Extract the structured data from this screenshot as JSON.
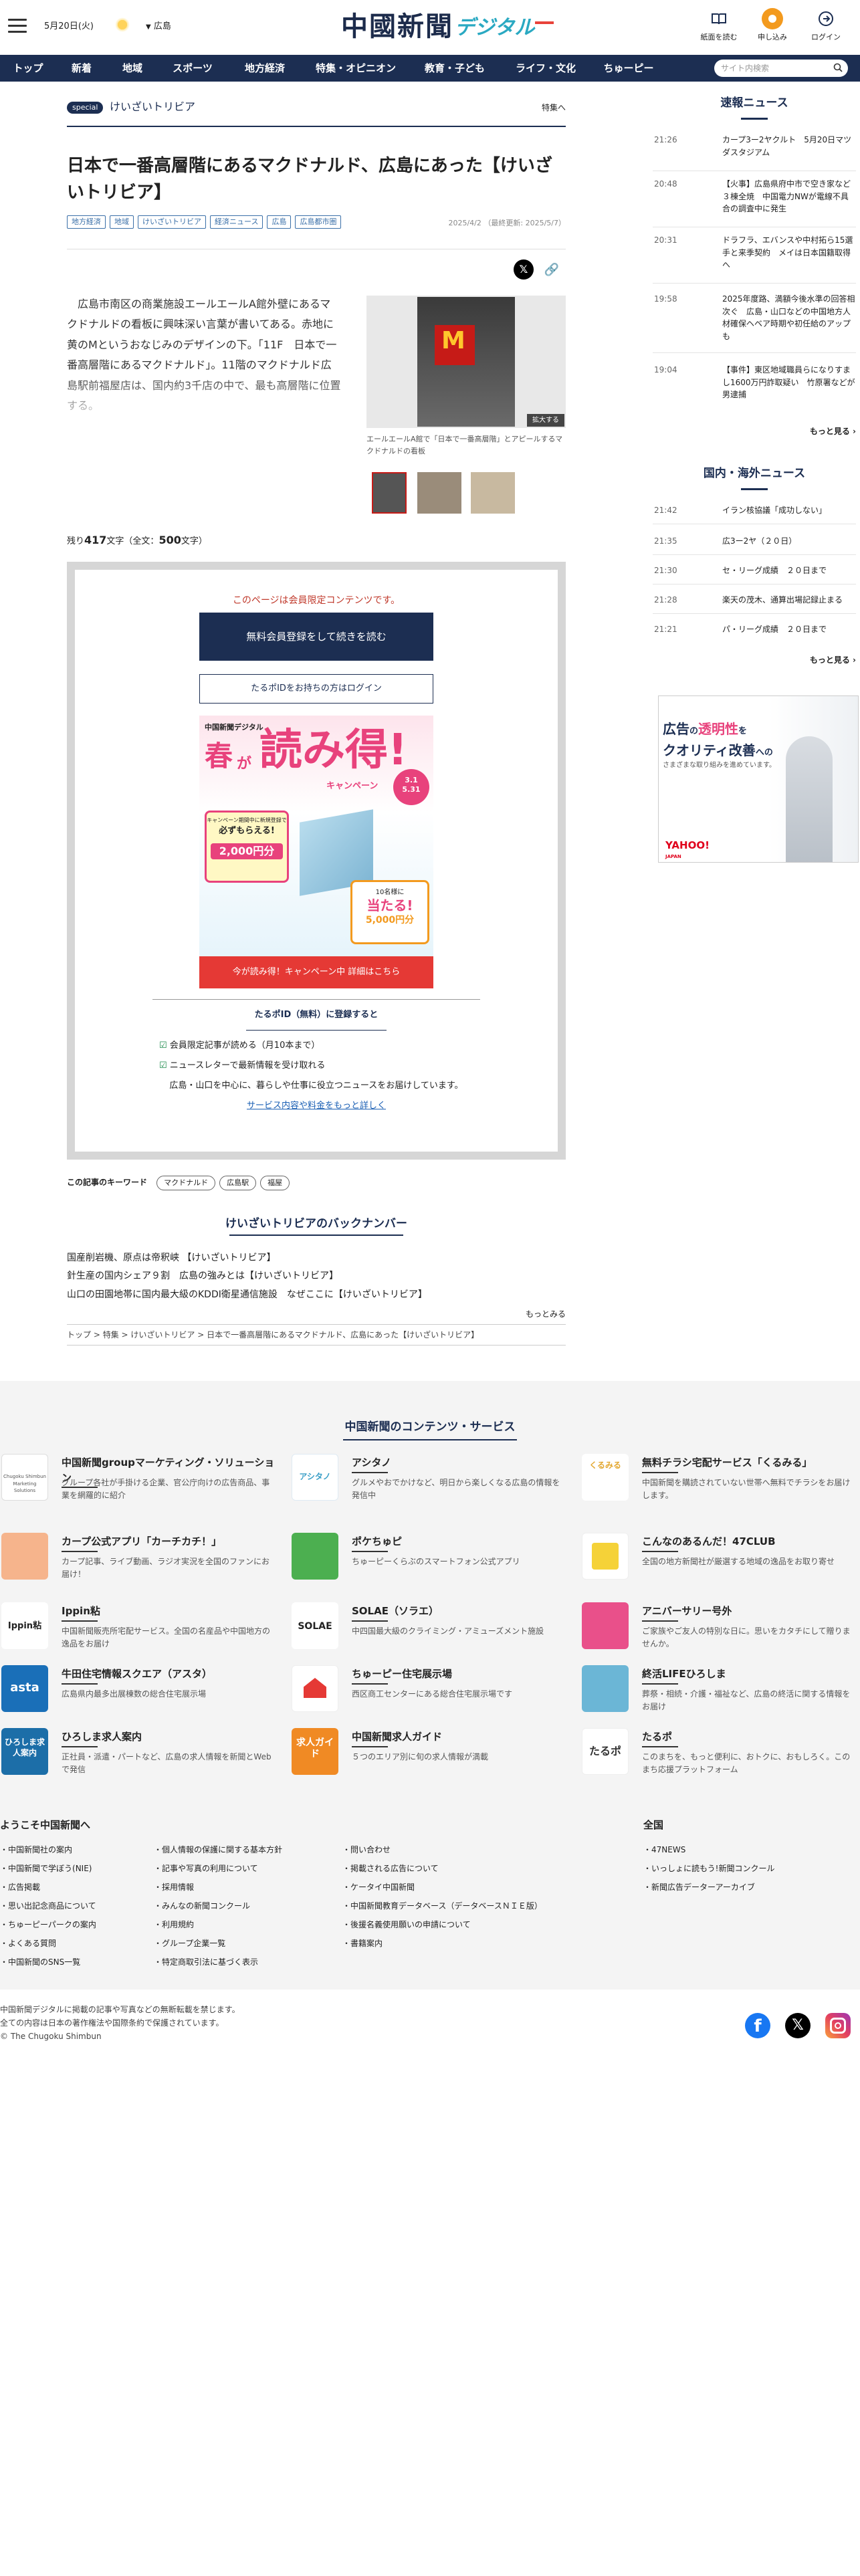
{
  "header": {
    "date": "5月20日(火)",
    "region": "広島",
    "logo_main": "中國新聞",
    "logo_sub": "デジタル",
    "buttons": [
      {
        "label": "紙面を読む"
      },
      {
        "label": "申し込み"
      },
      {
        "label": "ログイン"
      }
    ]
  },
  "nav": {
    "items": [
      "トップ",
      "新着",
      "地域",
      "スポーツ",
      "地方経済",
      "特集・オピニオン",
      "教育・子ども",
      "ライフ・文化",
      "ちゅーピー"
    ],
    "search_placeholder": "サイト内検索"
  },
  "series": {
    "badge": "special",
    "name": "けいざいトリビア",
    "link": "特集へ"
  },
  "article": {
    "title": "日本で一番高層階にあるマクドナルド、広島にあった【けいざいトリビア】",
    "tags": [
      "地方経済",
      "地域",
      "けいざいトリビア",
      "経済ニュース",
      "広島",
      "広島都市圏"
    ],
    "date": "2025/4/2",
    "updated": "（最終更新: 2025/5/7）",
    "lead": "広島市南区の商業施設エールエールA館外壁にあるマクドナルドの看板に興味深い言葉が書いてある。赤地に黄のMというおなじみのデザインの下。「11F　日本で一番高層階にあるマクドナルド」。11階のマクドナルド広島駅前福屋店は、国内約3千店の中で、最も高層階に位置する。",
    "photo_caption": "エールエールA館で「日本で一番高層階」とアピールするマクドナルドの看板",
    "enlarge": "拡大する",
    "remaining_prefix": "残り",
    "remaining_count": "417",
    "remaining_mid": "文字（全文：",
    "total_count": "500",
    "remaining_suffix": "文字）"
  },
  "paywall": {
    "notice": "このページは会員限定コンテンツです。",
    "register_button": "無料会員登録をして続きを読む",
    "login_button": "たるポIDをお持ちの方はログイン",
    "promo": {
      "top_label": "中国新聞デジタル",
      "title_a": "春",
      "title_b": "が",
      "title_c": "読み得!",
      "campaign": "キャンペーン",
      "period_a": "3.1",
      "period_b": "5.31",
      "gift_a": "キャンペーン期間中に新規登録で",
      "gift_b": "必ずもらえる!",
      "gift_c": "2,000円分",
      "lot_a": "10名様に",
      "lot_b": "当たる!",
      "lot_c": "5,000円分"
    },
    "campaign_button": "今が読み得！キャンペーン中 詳細はこちら",
    "benefit_title": "たるポID（無料）に登録すると",
    "benefits": [
      "会員限定記事が読める（月10本まで）",
      "ニュースレターで最新情報を受け取れる"
    ],
    "benefit_note": "広島・山口を中心に、暮らしや仕事に役立つニュースをお届けしています。",
    "detail_link": "サービス内容や料金をもっと詳しく"
  },
  "keywords": {
    "label": "この記事のキーワード",
    "items": [
      "マクドナルド",
      "広島駅",
      "福屋"
    ]
  },
  "backnumber": {
    "title": "けいざいトリビアのバックナンバー",
    "items": [
      "国産削岩機、原点は帝釈峡 【けいざいトリビア】",
      "針生産の国内シェア９割　広島の強みとは【けいざいトリビア】",
      "山口の田園地帯に国内最大級のKDDI衛星通信施設　なぜここに【けいざいトリビア】"
    ],
    "more": "もっとみる"
  },
  "breadcrumb": [
    "トップ",
    "特集",
    "けいざいトリビア",
    "日本で一番高層階にあるマクドナルド、広島にあった【けいざいトリビア】"
  ],
  "sidebar": {
    "latest_title": "速報ニュース",
    "latest": [
      {
        "time": "21:26",
        "headline": "カープ3ー2ヤクルト　5月20日マツダスタジアム"
      },
      {
        "time": "20:48",
        "headline": "【火事】広島県府中市で空き家など３棟全焼　中国電力NWが電線不具合の調査中に発生"
      },
      {
        "time": "20:31",
        "headline": "ドラフラ、エバンスや中村拓ら15選手と来季契約　メイは日本国籍取得へ"
      },
      {
        "time": "19:58",
        "headline": "2025年度路、満額今後水準の回答相次ぐ　広島・山口などの中国地方人材確保ヘベア時期や初任給のアップも"
      },
      {
        "time": "19:04",
        "headline": "【事件】東区地域職員らになりすまし1600万円詐取疑い　竹原署などが男逮捕"
      }
    ],
    "latest_more": "もっと見る",
    "world_title": "国内・海外ニュース",
    "world": [
      {
        "time": "21:42",
        "headline": "イラン核協議「成功しない」"
      },
      {
        "time": "21:35",
        "headline": "広3ー2ヤ（２０日）"
      },
      {
        "time": "21:30",
        "headline": "セ・リーグ成績　２０日まで"
      },
      {
        "time": "21:28",
        "headline": "楽天の茂木、通算出場記録止まる"
      },
      {
        "time": "21:21",
        "headline": "パ・リーグ成績　２０日まで"
      }
    ],
    "world_more": "もっと見る",
    "ad": {
      "line1a": "広告",
      "line1b": "の",
      "line1c": "透明性",
      "line1d": "を",
      "line2a": "クオリティ改善",
      "line2b": "への",
      "line3": "さまざまな取り組みを進めています。",
      "brand": "YAHOO!",
      "brand_sub": "JAPAN"
    }
  },
  "services": {
    "title": "中国新聞のコンテンツ・サービス",
    "items": [
      {
        "name": "中国新聞groupマーケティング・ソリューション",
        "desc": "グループ各社が手掛ける企業、官公庁向けの広告商品、事業を網羅的に紹介",
        "logo": "Chugoku Shimbun Marketing Solutions"
      },
      {
        "name": "アシタノ",
        "desc": "グルメやおでかけなど、明日から楽しくなる広島の情報を発信中",
        "logo": "アシタノ"
      },
      {
        "name": "無料チラシ宅配サービス「くるみる」",
        "desc": "中国新聞を購読されていない世帯へ無料でチラシをお届けします。",
        "logo": "くるみる"
      },
      {
        "name": "カープ公式アプリ「カーチカチ！」",
        "desc": "カープ記事、ライブ動画、ラジオ実況を全国のファンにお届け！",
        "logo": ""
      },
      {
        "name": "ポケちゅピ",
        "desc": "ちゅーピーくらぶのスマートフォン公式アプリ",
        "logo": ""
      },
      {
        "name": "こんなのあるんだ！47CLUB",
        "desc": "全国の地方新聞社が厳選する地域の逸品をお取り寄せ",
        "logo": ""
      },
      {
        "name": "Ippin粘",
        "desc": "中国新聞販売所宅配サービス。全国の名産品や中国地方の逸品をお届け",
        "logo": "Ippin粘"
      },
      {
        "name": "SOLAE（ソラエ）",
        "desc": "中四国最大級のクライミング・アミューズメント施設",
        "logo": "SOLAE"
      },
      {
        "name": "アニバーサリー号外",
        "desc": "ご家族やご友人の特別な日に。思いをカタチにして贈りませんか。",
        "logo": ""
      },
      {
        "name": "牛田住宅情報スクエア（アスタ）",
        "desc": "広島県内最多出展棟数の総合住宅展示場",
        "logo": "asta"
      },
      {
        "name": "ちゅーピー住宅展示場",
        "desc": "西区商工センターにある総合住宅展示場です",
        "logo": ""
      },
      {
        "name": "終活LIFEひろしま",
        "desc": "葬祭・相続・介護・福祉など、広島の終活に関する情報をお届け",
        "logo": ""
      },
      {
        "name": "ひろしま求人案内",
        "desc": "正社員・派遣・パートなど、広島の求人情報を新聞とWebで発信",
        "logo": "ひろしま求人案内"
      },
      {
        "name": "中国新聞求人ガイド",
        "desc": "５つのエリア別に旬の求人情報が満載",
        "logo": "求人ガイド"
      },
      {
        "name": "たるポ",
        "desc": "このまちを、もっと便利に、おトクに、おもしろく。このまち応援プラットフォーム",
        "logo": "たるポ"
      }
    ]
  },
  "footer": {
    "welcome_title": "ようこそ中国新聞へ",
    "col1": [
      "中国新聞社の案内",
      "中国新聞で学ぼう(NIE)",
      "広告掲載",
      "思い出記念商品について",
      "ちゅーピーパークの案内",
      "よくある質問",
      "中国新聞のSNS一覧"
    ],
    "col2": [
      "個人情報の保護に関する基本方針",
      "記事や写真の利用について",
      "採用情報",
      "みんなの新聞コンクール",
      "利用規約",
      "グループ企業一覧",
      "特定商取引法に基づく表示"
    ],
    "col3": [
      "問い合わせ",
      "掲載される広告について",
      "ケータイ中国新聞",
      "中国新聞教育データベース（データベースＮＩＥ版）",
      "後援名義使用願いの申請について",
      "書籍案内"
    ],
    "national_title": "全国",
    "col4": [
      "47NEWS",
      "いっしょに読もう!新聞コンクール",
      "新聞広告データーアーカイブ"
    ],
    "copy1": "中国新聞デジタルに掲載の記事や写真などの無断転載を禁じます。",
    "copy2": "全ての内容は日本の著作権法や国際条約で保護されています。",
    "copy3": "© The Chugoku Shimbun"
  }
}
